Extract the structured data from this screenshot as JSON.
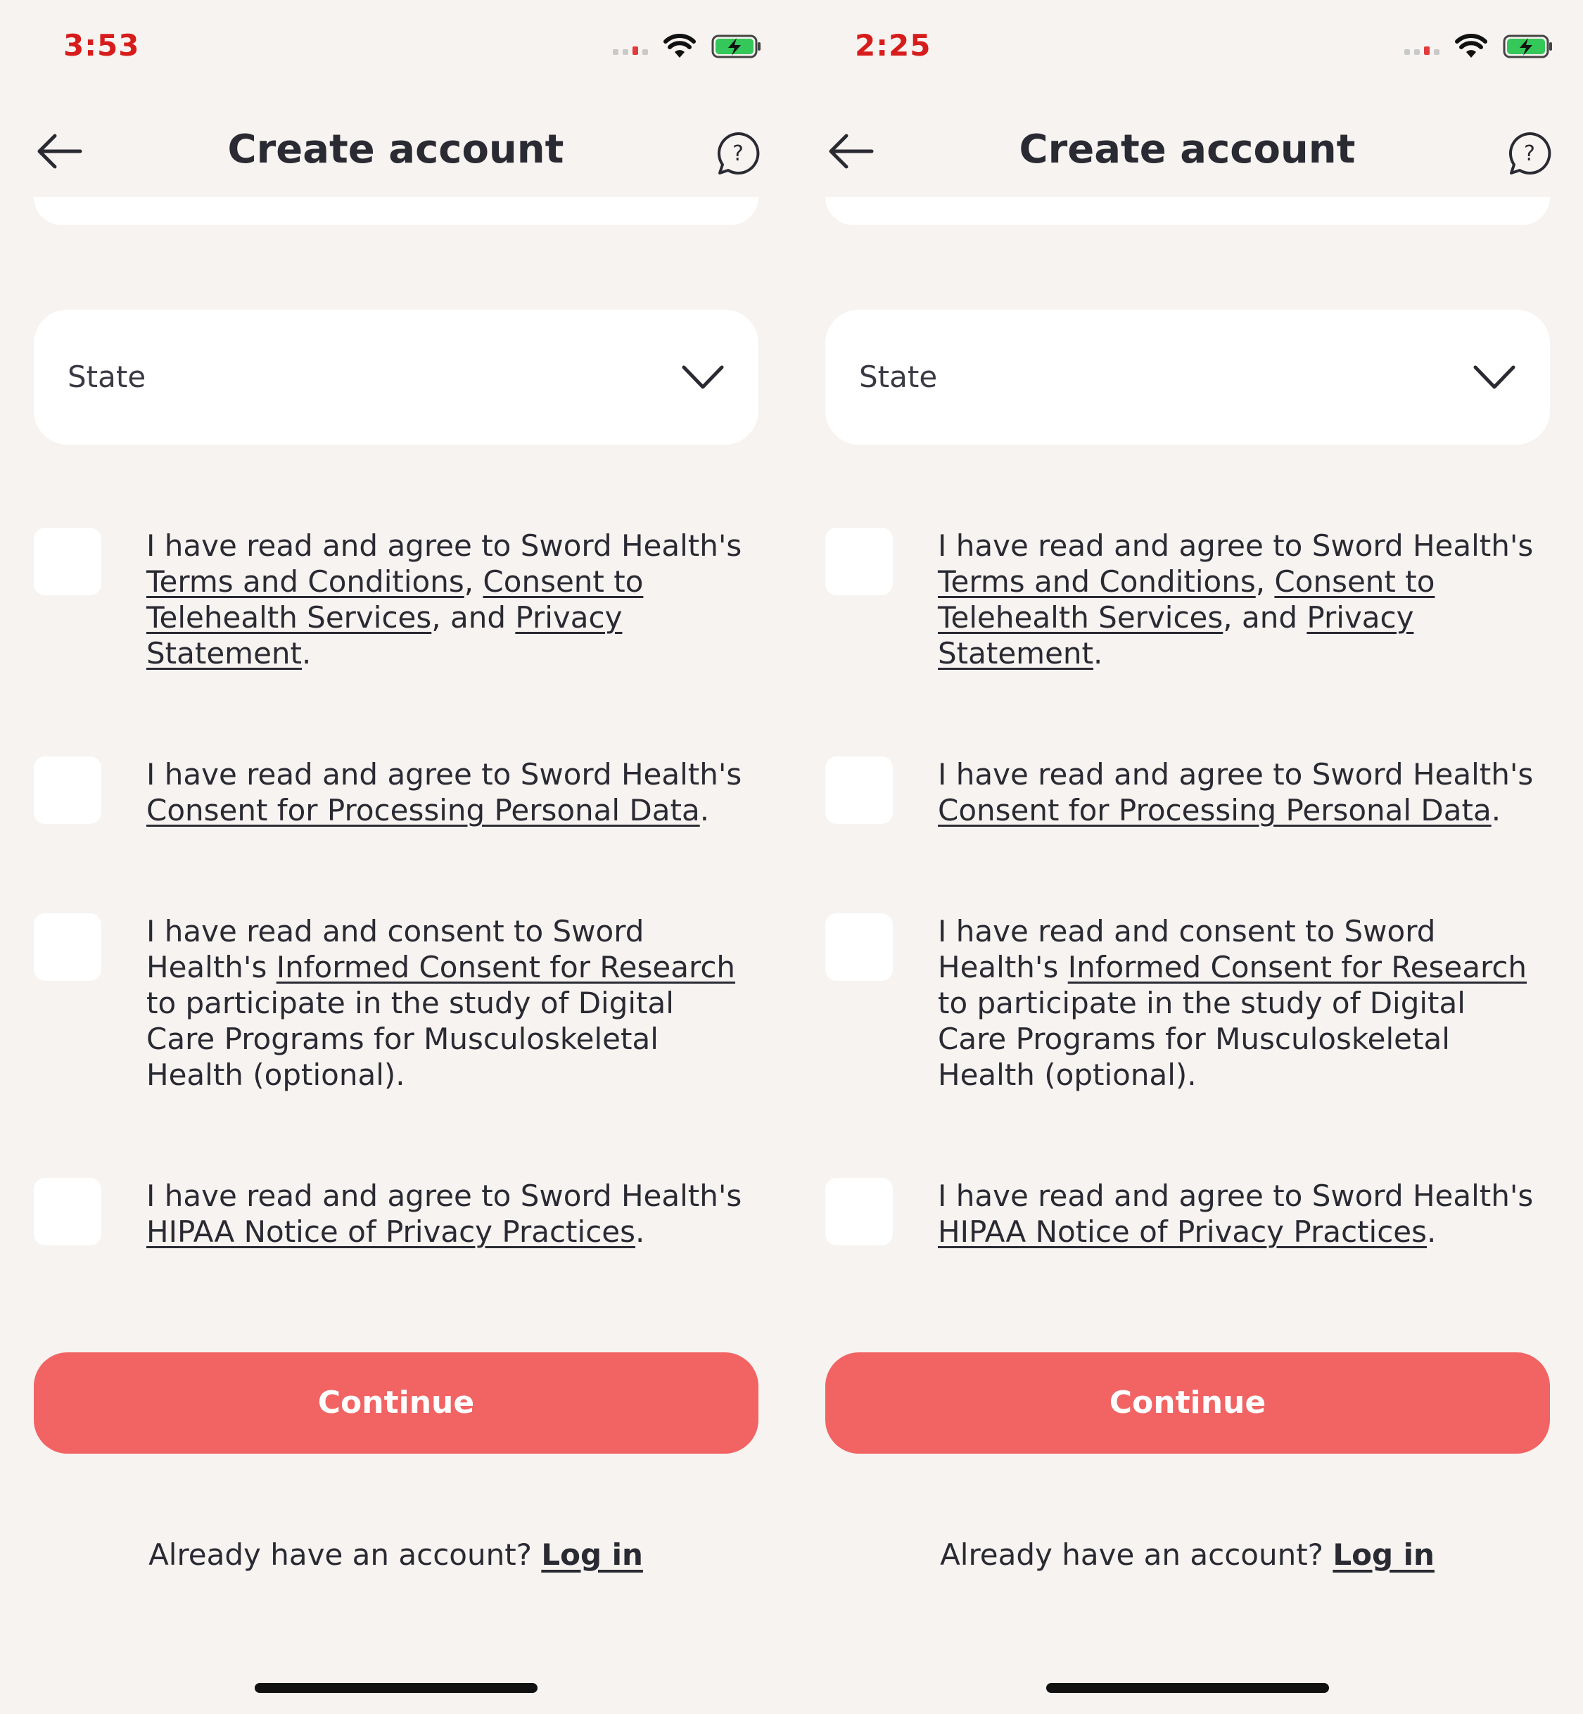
{
  "colors": {
    "background": "#f6f3f0",
    "card": "#ffffff",
    "accent_button": "#f26363",
    "text": "#2a2a33",
    "status_time": "#d71c1c",
    "battery": "#34c759"
  },
  "screens": [
    {
      "status_time": "3:53",
      "title": "Create account",
      "state_placeholder": "State",
      "consents": [
        {
          "pre": "I have read and agree to Sword Health's ",
          "link1": "Terms and Conditions",
          "sep1": ", ",
          "link2": "Consent to Telehealth Services",
          "sep2": ", and ",
          "link3": "Privacy Statement",
          "post": "."
        },
        {
          "pre": "I have read and agree to Sword Health's ",
          "link1": "Consent for Processing Personal Data",
          "post": "."
        },
        {
          "pre": "I have read and consent to Sword Health's ",
          "link1": "Informed Consent for Research",
          "post": " to participate in the study of Digital Care Programs for Musculoskeletal Health (optional)."
        },
        {
          "pre": "I have read and agree to Sword Health's ",
          "link1": "HIPAA Notice of Privacy Practices",
          "post": "."
        }
      ],
      "continue_label": "Continue",
      "login_prompt": "Already have an account? ",
      "login_link": "Log in"
    },
    {
      "status_time": "2:25",
      "title": "Create account",
      "state_placeholder": "State",
      "consents": [
        {
          "pre": "I have read and agree to Sword Health's ",
          "link1": "Terms and Conditions",
          "sep1": ", ",
          "link2": "Consent to Telehealth Services",
          "sep2": ", and ",
          "link3": "Privacy Statement",
          "post": "."
        },
        {
          "pre": "I have read and agree to Sword Health's ",
          "link1": "Consent for Processing Personal Data",
          "post": "."
        },
        {
          "pre": "I have read and consent to Sword Health's ",
          "link1": "Informed Consent for Research",
          "post": " to participate in the study of Digital Care Programs for Musculoskeletal Health (optional)."
        },
        {
          "pre": "I have read and agree to Sword Health's ",
          "link1": "HIPAA Notice of Privacy Practices",
          "post": "."
        }
      ],
      "continue_label": "Continue",
      "login_prompt": "Already have an account? ",
      "login_link": "Log in"
    }
  ]
}
